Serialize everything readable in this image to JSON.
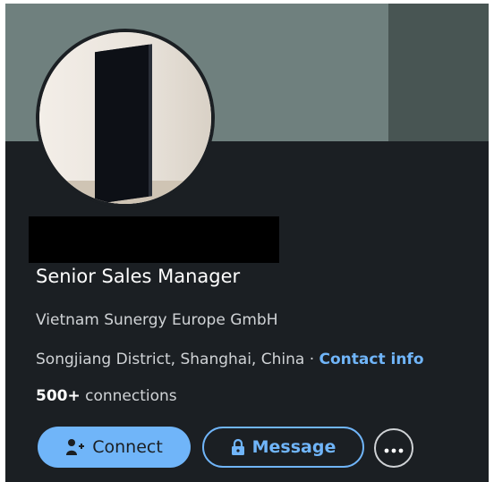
{
  "profile": {
    "headline": "Senior Sales Manager",
    "company": "Vietnam Sunergy Europe GmbH",
    "location": "Songjiang District, Shanghai, China",
    "separator": " · ",
    "contact_info_label": "Contact info",
    "connections_count": "500+",
    "connections_label": " connections"
  },
  "actions": {
    "connect_label": "Connect",
    "message_label": "Message"
  },
  "icons": {
    "connect": "add-person-icon",
    "message": "lock-icon",
    "more": "more-horizontal-icon"
  },
  "colors": {
    "accent": "#70b5f9",
    "background": "#1b1f23",
    "text_primary": "#ffffff",
    "text_secondary": "#d0d3d6"
  }
}
